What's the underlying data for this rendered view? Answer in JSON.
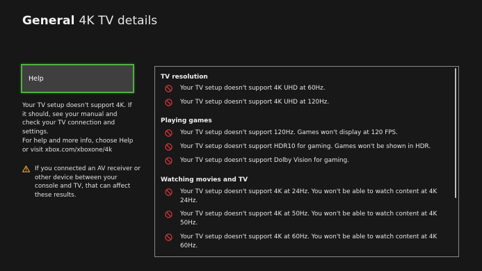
{
  "header": {
    "section": "General",
    "page": "4K TV details"
  },
  "left": {
    "help_label": "Help",
    "para1": "Your TV setup doesn't support 4K. If it should, see your manual and check your TV connection and settings.",
    "para2": "For help and more info, choose Help or visit xbox.com/xboxone/4k",
    "warning": "If you connected an AV receiver or other device between your console and TV, that can affect these results."
  },
  "panel": {
    "groups": [
      {
        "title": "TV resolution",
        "items": [
          "Your TV setup doesn't support 4K UHD at 60Hz.",
          "Your TV setup doesn't support 4K UHD at 120Hz."
        ]
      },
      {
        "title": "Playing games",
        "items": [
          "Your TV setup doesn't support 120Hz. Games won't display at 120 FPS.",
          "Your TV setup doesn't support HDR10 for gaming. Games won't be shown in HDR.",
          "Your TV setup doesn't support Dolby Vision for gaming."
        ]
      },
      {
        "title": "Watching movies and TV",
        "items": [
          "Your TV setup doesn't support 4K at 24Hz. You won't be able to watch content at 4K 24Hz.",
          "Your TV setup doesn't support 4K at 50Hz. You won't be able to watch content at 4K 50Hz.",
          "Your TV setup doesn't support 4K at 60Hz. You won't be able to watch content at 4K 60Hz."
        ]
      }
    ]
  },
  "icons": {
    "unsupported": "no-entry-icon",
    "warning": "warning-triangle-icon"
  },
  "colors": {
    "focus_border": "#52b043",
    "unsupported_icon": "#e0383e",
    "warning_icon": "#e8a33a",
    "background": "#171717"
  }
}
